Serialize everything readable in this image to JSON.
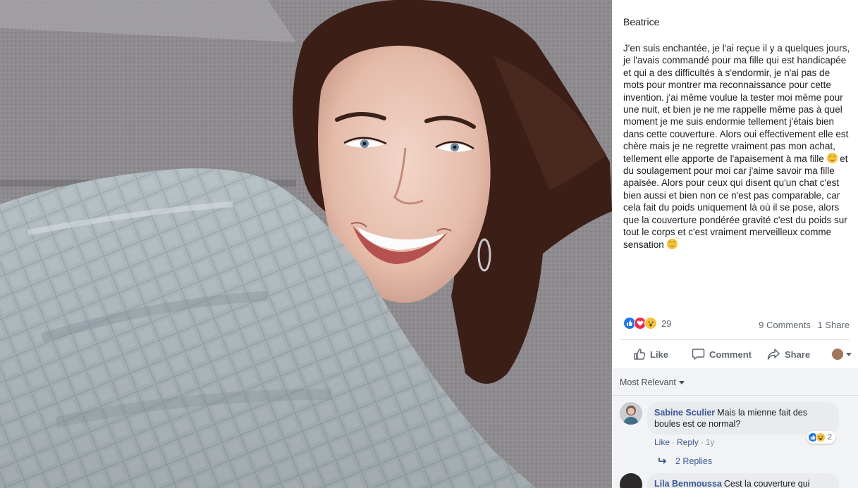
{
  "post": {
    "author": "Beatrice",
    "text_parts": [
      "J'en suis enchantée, je l'ai reçue il y a quelques jours, je l'avais commandé pour ma fille qui est handicapée et qui a des difficultés à s'endormir, je n'ai pas de mots pour montrer ma reconnaissance pour cette invention. j'ai même voulue la tester moi même pour une nuit, et bien je ne me rappelle même pas à quel moment je me suis endormie tellement j'étais bien dans cette couverture. Alors oui effectivement elle est chère mais je ne regrette vraiment pas mon achat, tellement elle apporte de l'apaisement à ma fille ",
      " et du soulagement pour moi car j'aime savoir ma fille apaisée. Alors pour ceux qui disent qu'un chat c'est bien aussi et bien non ce n'est pas comparable, car cela fait du poids uniquement là où il se pose, alors que la couverture pondérée gravité c'est du poids sur tout le corps et c'est vraiment merveilleux comme sensation "
    ],
    "emoji_name": "smiling-face-emoji"
  },
  "reactions": {
    "icons": [
      "like-reaction-icon",
      "love-reaction-icon",
      "wow-reaction-icon"
    ],
    "count": "29",
    "comments": "9 Comments",
    "shares": "1 Share"
  },
  "actions": {
    "like": "Like",
    "comment": "Comment",
    "share": "Share"
  },
  "comments_section": {
    "sort_label": "Most Relevant",
    "comments": [
      {
        "name": "Sabine Sculier",
        "text": "Mais la mienne fait des boules est ce normal?",
        "like": "Like",
        "reply": "Reply",
        "time": "1y",
        "reaction_count": "2",
        "replies_label": "2 Replies"
      },
      {
        "name": "Lila Benmoussa",
        "text": "Cest la couverture qui"
      }
    ]
  },
  "colors": {
    "link": "#385898",
    "like_blue": "#1877f2",
    "love_red": "#f0284a",
    "wow_yellow": "#f7c338",
    "muted": "#606770"
  }
}
